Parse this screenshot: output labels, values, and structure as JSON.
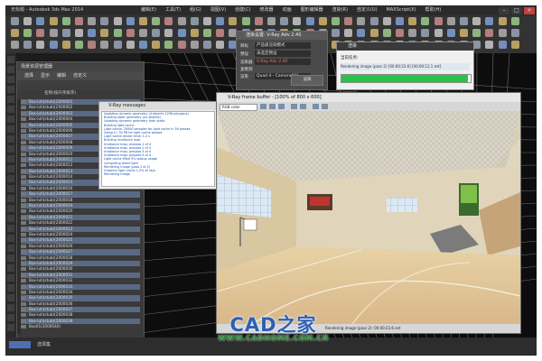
{
  "app": {
    "title": "无标题 - Autodesk 3ds Max 2014",
    "menus": [
      "编辑(E)",
      "工具(T)",
      "组(G)",
      "视图(V)",
      "创建(C)",
      "修改器",
      "动画",
      "图形编辑器",
      "渲染(R)",
      "自定义(U)",
      "MAXScript(X)",
      "帮助(H)"
    ]
  },
  "scene_panel": {
    "title": "场景资源管理器",
    "tabs": [
      "选择",
      "显示",
      "编辑",
      "自定义"
    ],
    "subheader": "名称(按升序排序)",
    "items": [
      "Box-luh(stub)(2000001",
      "Box-luh(stub)(2000002",
      "Box-luh(stub)(2000003",
      "Box-luh(stub)(2000004",
      "Box-luh(stub)(2000005",
      "Box-luh(stub)(2000006",
      "Box-luh(stub)(2000007",
      "Box-luh(stub)(2000008",
      "Box-luh(stub)(2000009",
      "Box-luh(stub)(2000010",
      "Box-luh(stub)(2000011",
      "Box-luh(stub)(2000012",
      "Box-luh(stub)(2000013",
      "Box-luh(stub)(2000014",
      "Box-luh(stub)(2000015",
      "Box-luh(stub)(2000016",
      "Box-luh(stub)(2000017",
      "Box-luh(stub)(2000018",
      "Box-luh(stub)(2000019",
      "Box-luh(stub)(2000020",
      "Box-luh(stub)(2000021",
      "Box-luh(stub)(2000022",
      "Box-luh(stub)(2000023",
      "Box-luh(stub)(2000024",
      "Box-luh(stub)(2000025",
      "Box-luh(stub)(2000026",
      "Box-luh(stub)(2000027",
      "Box-luh(stub)(2000028",
      "Box-luh(stub)(2000029",
      "Box-luh(stub)(2000030",
      "Box-luh(stub)(2000031",
      "Box-luh(stub)(2000032",
      "Box-luh(stub)(2000033",
      "Box-luh(stub)(2000034",
      "Box-luh(stub)(2000035",
      "Box-luh(stub)(2000036",
      "Box-luh(stub)(2000037",
      "Box-luh(stub)(2000038",
      "Box-luh(stub)(2000039",
      "Box01(2000040)"
    ]
  },
  "vray_messages": {
    "title": "V-Ray messages",
    "lines": [
      "Updating dynamic geometry (4 objects 1296 polygons)",
      "Building static geometry (no objects)",
      "Updating dynamic geometry from static",
      "Building light cache",
      "Light cache: 20000 samples for light cache in 59 passes",
      "Doing 0 / 30 PB for light cache passes",
      "Light cache render time: 1.2 s",
      "Building irradiance map",
      "Irradiance map: prepass 1 of 4",
      "Irradiance map: prepass 2 of 4",
      "Irradiance map: prepass 3 of 4",
      "Irradiance map: prepass 4 of 4",
      "Light cache filled 5% lookup usage",
      "Computing direct light",
      "Rendering image (pass 2 of 2)",
      "Graphics light cache 1.2% of rays",
      "Rendering image"
    ]
  },
  "render_setup": {
    "title": "渲染设置: V-Ray Adv 2.40",
    "rows": [
      {
        "label": "目标",
        "value": "产品级渲染模式"
      },
      {
        "label": "预设",
        "value": "未选定预设"
      },
      {
        "label": "渲染器",
        "value": "V-Ray Adv 2.40"
      },
      {
        "label": "查看到渲染",
        "value": "Quad 4 - Camera001"
      }
    ],
    "render_button": "渲染"
  },
  "progress": {
    "title": "渲染",
    "label": "当前任务:",
    "status": "Rendering image (pass 2) [00:00:23.6] [00:00:12.1 est]",
    "fraction": 0.98
  },
  "frame_buffer": {
    "title": "V-Ray frame buffer - [100% of 800 x 600]",
    "channel": "RGB color",
    "status": "Rendering image (pass 2): 00:00:23.6 est"
  },
  "bottom": {
    "label": "选择集"
  },
  "watermark": {
    "logo": "CAD之家",
    "url": "WWW.CADHOME.COM.CN"
  }
}
